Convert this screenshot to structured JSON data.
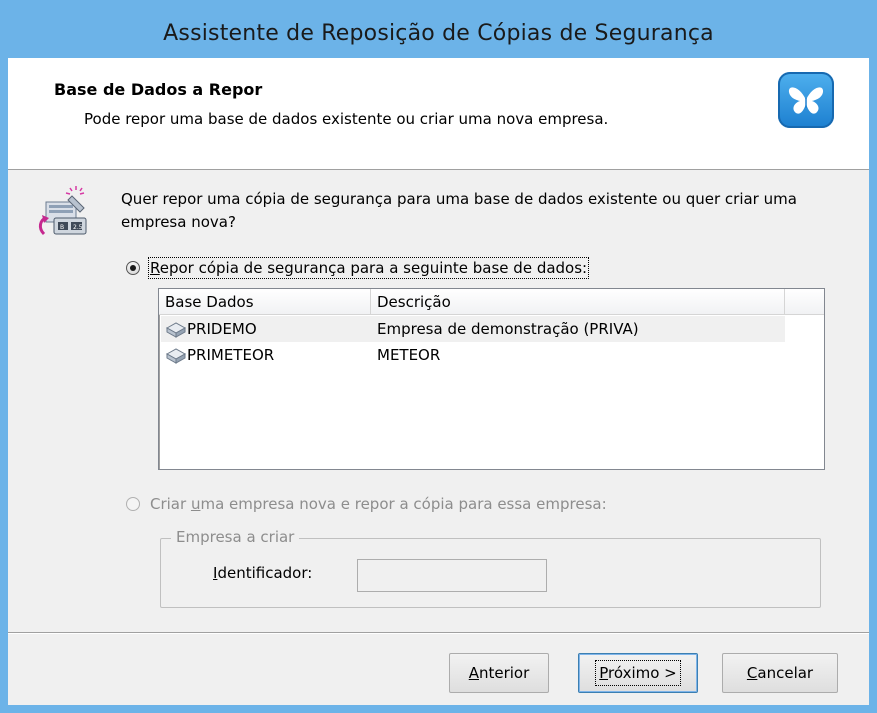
{
  "window": {
    "title": "Assistente de Reposição de Cópias de Segurança"
  },
  "header": {
    "title": "Base de Dados a Repor",
    "subtitle": "Pode repor uma base de dados existente ou criar uma nova empresa.",
    "logo_icon": "butterfly-logo-icon"
  },
  "question": "Quer repor uma cópia de segurança para uma base de dados existente ou quer criar uma empresa nova?",
  "options": {
    "restore_existing": {
      "label_access_key": "R",
      "label_rest": "epor cópia de segurança para a seguinte base de dados:",
      "checked": true
    },
    "create_new": {
      "label_pre": "Criar ",
      "label_access_key": "u",
      "label_rest": "ma empresa nova e repor a cópia para essa empresa:",
      "checked": false,
      "enabled": false
    }
  },
  "databases": {
    "columns": [
      "Base Dados",
      "Descrição"
    ],
    "rows": [
      {
        "name": "PRIDEMO",
        "description": "Empresa de demonstração (PRIVA)",
        "selected": true
      },
      {
        "name": "PRIMETEOR",
        "description": "METEOR",
        "selected": false
      }
    ]
  },
  "new_company": {
    "group_label": "Empresa a criar",
    "field_access_key": "I",
    "field_label_rest": "dentificador:",
    "value": ""
  },
  "buttons": {
    "previous": {
      "access_key": "A",
      "rest": "nterior"
    },
    "next": {
      "access_key": "P",
      "rest": "róximo >"
    },
    "cancel": {
      "access_key": "C",
      "rest": "ancelar"
    }
  }
}
